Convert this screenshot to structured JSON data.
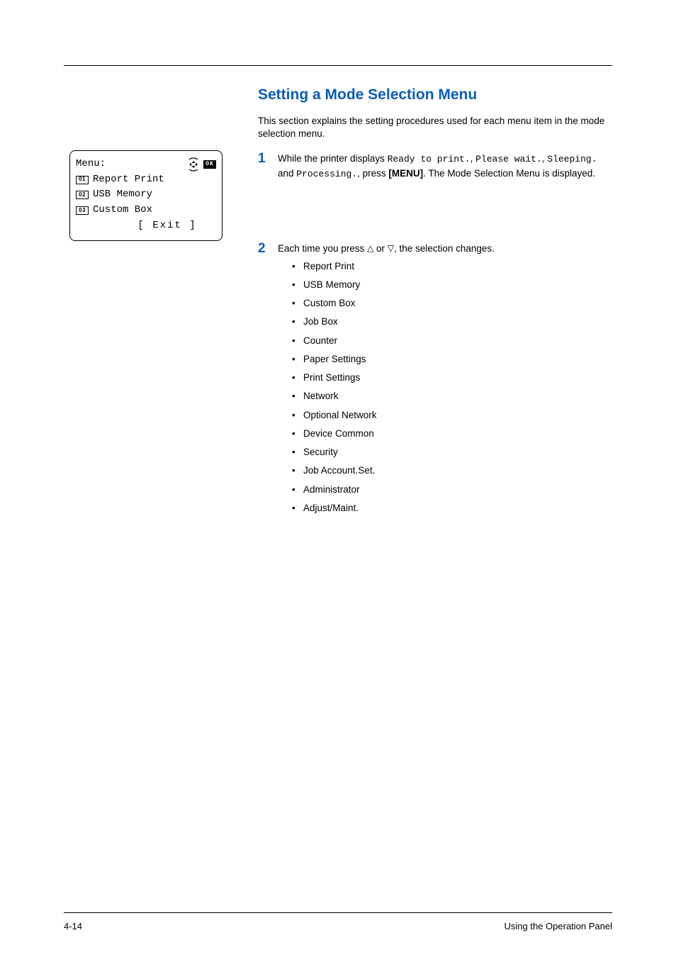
{
  "section_title": "Setting a Mode Selection Menu",
  "intro": "This section explains the setting procedures used for each menu item in the mode selection menu.",
  "display": {
    "title": "Menu:",
    "ok_label": "OK",
    "items": [
      {
        "num": "01",
        "label": "Report Print"
      },
      {
        "num": "02",
        "label": "USB Memory"
      },
      {
        "num": "03",
        "label": "Custom Box"
      }
    ],
    "exit": "[  Exit  ]"
  },
  "step1": {
    "num": "1",
    "pre": "While the printer displays ",
    "m1": "Ready to print.",
    "sep1": ", ",
    "m2": "Please wait.",
    "sep2": ", ",
    "m3": "Sleeping.",
    "sep3": " and ",
    "m4": "Processing.",
    "sep4": ", press ",
    "menu": "[MENU]",
    "post": ". The Mode Selection Menu is displayed."
  },
  "step2": {
    "num": "2",
    "pre": "Each time you press ",
    "mid": " or ",
    "post": ", the selection changes.",
    "items": [
      "Report Print",
      "USB Memory",
      "Custom Box",
      "Job Box",
      "Counter",
      "Paper Settings",
      "Print Settings",
      "Network",
      "Optional Network",
      "Device Common",
      "Security",
      "Job Account.Set.",
      "Administrator",
      "Adjust/Maint."
    ]
  },
  "footer": {
    "left": "4-14",
    "right": "Using the Operation Panel"
  }
}
